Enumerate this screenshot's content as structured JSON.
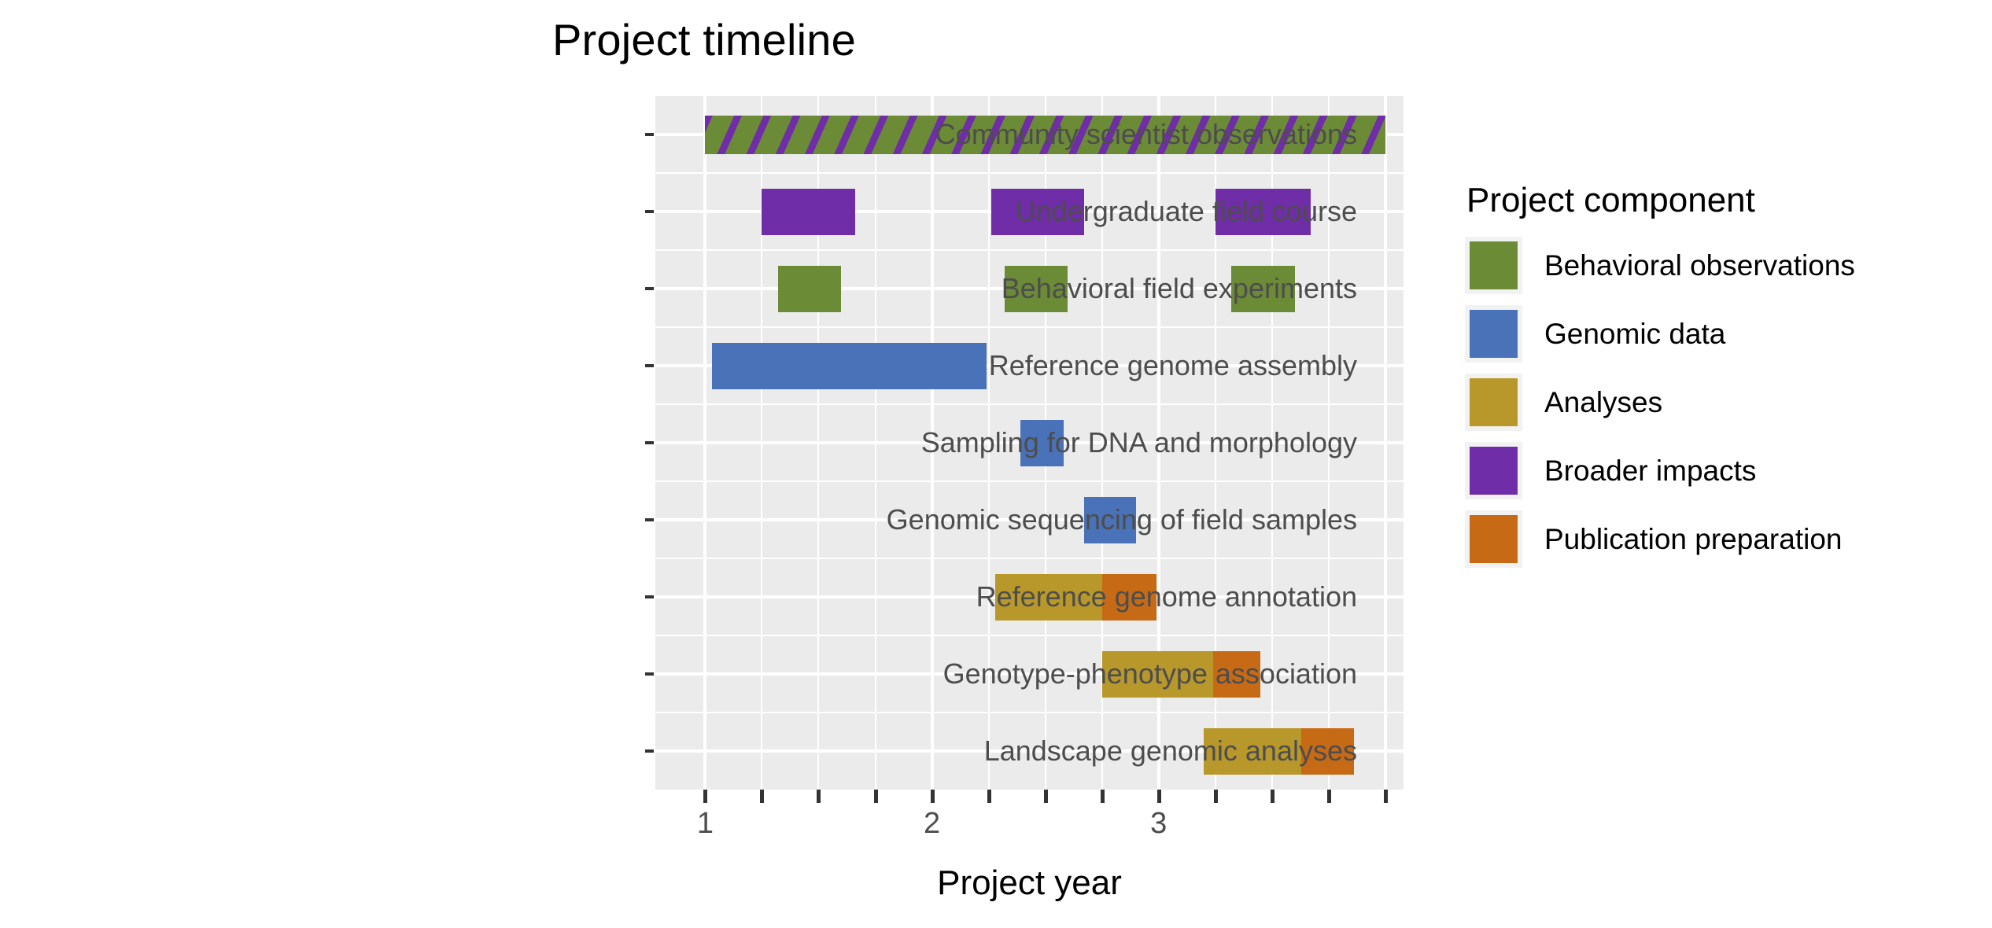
{
  "chart_data": {
    "type": "bar",
    "chart_subtype": "gantt",
    "title": "Project timeline",
    "xlabel": "Project year",
    "ylabel": "",
    "xlim": [
      0.78,
      4.08
    ],
    "x_ticks": [
      1,
      2,
      3
    ],
    "x_tick_labels": [
      "1",
      "2",
      "3"
    ],
    "x_minor_tick_step": 0.25,
    "grid": true,
    "legend_position": "right",
    "legend_title": "Project component",
    "categories": [
      "Community scientist observations",
      "Undergraduate field course",
      "Behavioral field experiments",
      "Reference genome assembly",
      "Sampling for DNA and morphology",
      "Genomic sequencing of field samples",
      "Reference genome annotation",
      "Genotype-phenotype association",
      "Landscape genomic analyses"
    ],
    "series": [
      {
        "name": "Behavioral observations",
        "color": "#6c8b37"
      },
      {
        "name": "Genomic data",
        "color": "#4a72b8"
      },
      {
        "name": "Analyses",
        "color": "#b8972b"
      },
      {
        "name": "Broader impacts",
        "color": "#6f2da8"
      },
      {
        "name": "Publication preparation",
        "color": "#c76a16"
      }
    ],
    "tasks": [
      {
        "task": "Community scientist observations",
        "row": 0,
        "start": 1.0,
        "end": 4.0,
        "component": "Behavioral observations",
        "color": "#6c8b37",
        "pattern": "diagonal-stripes",
        "pattern_color": "#6f2da8"
      },
      {
        "task": "Undergraduate field course",
        "row": 1,
        "start": 1.25,
        "end": 1.66,
        "component": "Broader impacts",
        "color": "#6f2da8"
      },
      {
        "task": "Undergraduate field course",
        "row": 1,
        "start": 2.26,
        "end": 2.67,
        "component": "Broader impacts",
        "color": "#6f2da8"
      },
      {
        "task": "Undergraduate field course",
        "row": 1,
        "start": 3.25,
        "end": 3.67,
        "component": "Broader impacts",
        "color": "#6f2da8"
      },
      {
        "task": "Behavioral field experiments",
        "row": 2,
        "start": 1.32,
        "end": 1.6,
        "component": "Behavioral observations",
        "color": "#6c8b37"
      },
      {
        "task": "Behavioral field experiments",
        "row": 2,
        "start": 2.32,
        "end": 2.6,
        "component": "Behavioral observations",
        "color": "#6c8b37"
      },
      {
        "task": "Behavioral field experiments",
        "row": 2,
        "start": 3.32,
        "end": 3.6,
        "component": "Behavioral observations",
        "color": "#6c8b37"
      },
      {
        "task": "Reference genome assembly",
        "row": 3,
        "start": 1.03,
        "end": 2.24,
        "component": "Genomic data",
        "color": "#4a72b8"
      },
      {
        "task": "Sampling for DNA and morphology",
        "row": 4,
        "start": 2.39,
        "end": 2.58,
        "component": "Genomic data",
        "color": "#4a72b8"
      },
      {
        "task": "Genomic sequencing of field samples",
        "row": 5,
        "start": 2.67,
        "end": 2.9,
        "component": "Genomic data",
        "color": "#4a72b8"
      },
      {
        "task": "Reference genome annotation",
        "row": 6,
        "start": 2.28,
        "end": 2.75,
        "component": "Analyses",
        "color": "#b8972b"
      },
      {
        "task": "Reference genome annotation",
        "row": 6,
        "start": 2.75,
        "end": 2.99,
        "component": "Publication preparation",
        "color": "#c76a16"
      },
      {
        "task": "Genotype-phenotype association",
        "row": 7,
        "start": 2.75,
        "end": 3.24,
        "component": "Analyses",
        "color": "#b8972b"
      },
      {
        "task": "Genotype-phenotype association",
        "row": 7,
        "start": 3.24,
        "end": 3.45,
        "component": "Publication preparation",
        "color": "#c76a16"
      },
      {
        "task": "Landscape genomic analyses",
        "row": 8,
        "start": 3.2,
        "end": 3.63,
        "component": "Analyses",
        "color": "#b8972b"
      },
      {
        "task": "Landscape genomic analyses",
        "row": 8,
        "start": 3.63,
        "end": 3.86,
        "component": "Publication preparation",
        "color": "#c76a16"
      }
    ]
  },
  "title": "Project timeline",
  "axes": {
    "x_title": "Project year",
    "x_tick_labels": [
      "1",
      "2",
      "3"
    ],
    "y_tick_labels": [
      "Community scientist observations",
      "Undergraduate field course",
      "Behavioral field experiments",
      "Reference genome assembly",
      "Sampling for DNA and morphology",
      "Genomic sequencing of field samples",
      "Reference genome annotation",
      "Genotype-phenotype association",
      "Landscape genomic analyses"
    ]
  },
  "legend": {
    "title": "Project component",
    "items": [
      {
        "label": "Behavioral observations",
        "color": "#6c8b37"
      },
      {
        "label": "Genomic data",
        "color": "#4a72b8"
      },
      {
        "label": "Analyses",
        "color": "#b8972b"
      },
      {
        "label": "Broader impacts",
        "color": "#6f2da8"
      },
      {
        "label": "Publication preparation",
        "color": "#c76a16"
      }
    ]
  },
  "theme": {
    "panel_background": "#ebebeb",
    "grid_color": "#ffffff",
    "text_color": "#4d4d4d",
    "title_color": "#000000"
  }
}
